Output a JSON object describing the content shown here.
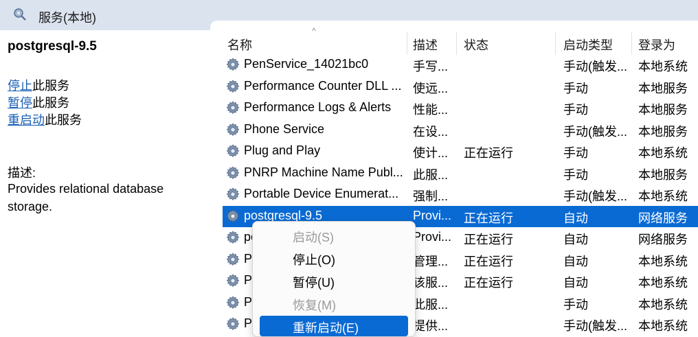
{
  "window": {
    "title": "服务(本地)"
  },
  "left_panel": {
    "service_name": "postgresql-9.5",
    "actions": [
      {
        "link": "停止",
        "suffix": "此服务"
      },
      {
        "link": "暂停",
        "suffix": "此服务"
      },
      {
        "link": "重启动",
        "suffix": "此服务"
      }
    ],
    "description_label": "描述:",
    "description": "Provides relational database storage."
  },
  "table": {
    "columns": {
      "name": "名称",
      "desc": "描述",
      "state": "状态",
      "start_type": "启动类型",
      "logon": "登录为"
    },
    "rows": [
      {
        "name": "PenService_14021bc0",
        "desc": "手写...",
        "state": "",
        "start_type": "手动(触发...",
        "logon": "本地系统"
      },
      {
        "name": "Performance Counter DLL ...",
        "desc": "使远...",
        "state": "",
        "start_type": "手动",
        "logon": "本地服务"
      },
      {
        "name": "Performance Logs & Alerts",
        "desc": "性能...",
        "state": "",
        "start_type": "手动",
        "logon": "本地服务"
      },
      {
        "name": "Phone Service",
        "desc": "在设...",
        "state": "",
        "start_type": "手动(触发...",
        "logon": "本地服务"
      },
      {
        "name": "Plug and Play",
        "desc": "使计...",
        "state": "正在运行",
        "start_type": "手动",
        "logon": "本地系统"
      },
      {
        "name": "PNRP Machine Name Publ...",
        "desc": "此服...",
        "state": "",
        "start_type": "手动",
        "logon": "本地服务"
      },
      {
        "name": "Portable Device Enumerat...",
        "desc": "强制...",
        "state": "",
        "start_type": "手动(触发...",
        "logon": "本地系统"
      },
      {
        "name": "postgresql-9.5",
        "desc": "Provi...",
        "state": "正在运行",
        "start_type": "自动",
        "logon": "网络服务"
      },
      {
        "name": "po",
        "desc": "Provi...",
        "state": "正在运行",
        "start_type": "自动",
        "logon": "网络服务"
      },
      {
        "name": "Po",
        "desc": "管理...",
        "state": "正在运行",
        "start_type": "自动",
        "logon": "本地系统"
      },
      {
        "name": "Pr",
        "desc": "该服...",
        "state": "正在运行",
        "start_type": "自动",
        "logon": "本地系统"
      },
      {
        "name": "Pr",
        "desc": "此服...",
        "state": "",
        "start_type": "手动",
        "logon": "本地系统"
      },
      {
        "name": "Pr",
        "desc": "提供...",
        "state": "",
        "start_type": "手动(触发...",
        "logon": "本地系统"
      }
    ]
  },
  "context_menu": {
    "items": [
      {
        "label": "启动(S)",
        "enabled": false
      },
      {
        "label": "停止(O)",
        "enabled": true
      },
      {
        "label": "暂停(U)",
        "enabled": true
      },
      {
        "label": "恢复(M)",
        "enabled": false
      },
      {
        "label": "重新启动(E)",
        "enabled": true,
        "highlighted": true
      }
    ]
  },
  "colors": {
    "selection": "#0a6ad3",
    "link": "#1a5fb4",
    "header_bg": "#dbe3ef"
  },
  "icons": {
    "window": "gear-search-icon",
    "row": "gear-icon"
  }
}
